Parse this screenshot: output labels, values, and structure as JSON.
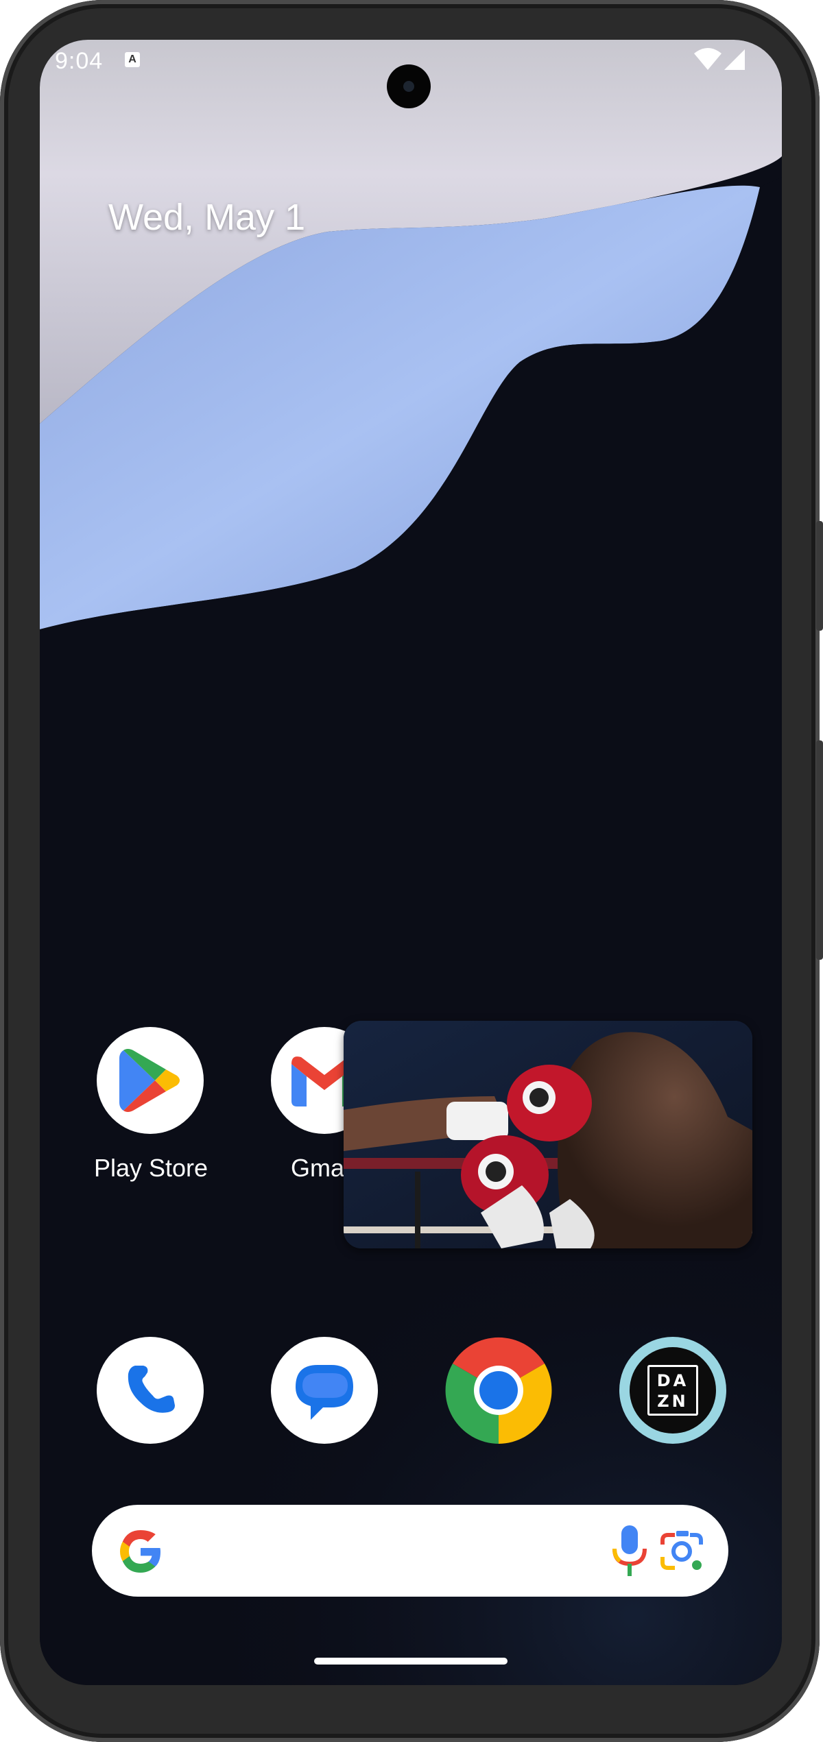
{
  "status_bar": {
    "time": "9:04",
    "notification_icon": "a-icon",
    "icons": [
      "wifi-icon",
      "cell-signal-icon"
    ]
  },
  "date": "Wed, May 1",
  "home_apps": [
    {
      "label": "Play Store",
      "icon": "play-store-icon"
    },
    {
      "label": "Gma",
      "icon": "gmail-icon"
    }
  ],
  "dock_apps": [
    {
      "icon": "phone-icon"
    },
    {
      "icon": "messages-icon"
    },
    {
      "icon": "chrome-icon"
    },
    {
      "icon": "dazn-icon",
      "text_top": "DA",
      "text_bottom": "ZN"
    }
  ],
  "pip": {
    "content": "boxing-video"
  },
  "search": {
    "icons": [
      "google-g-icon",
      "microphone-icon",
      "google-lens-icon"
    ]
  },
  "colors": {
    "google_blue": "#4285F4",
    "google_red": "#EA4335",
    "google_yellow": "#FBBC04",
    "google_green": "#34A853",
    "dazn_ring": "#9ad6e2"
  }
}
